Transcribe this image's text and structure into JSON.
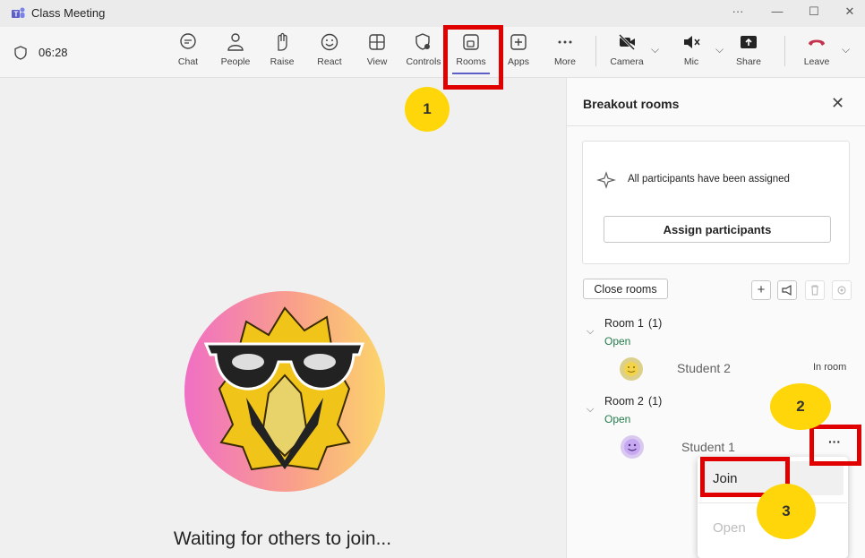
{
  "window": {
    "title": "Class Meeting",
    "controls": [
      "···",
      "—",
      "☐",
      "✕"
    ]
  },
  "toolbar": {
    "timer": "06:28",
    "items": [
      {
        "label": "Chat",
        "icon": "chat-icon"
      },
      {
        "label": "People",
        "icon": "people-icon"
      },
      {
        "label": "Raise",
        "icon": "raise-hand-icon"
      },
      {
        "label": "React",
        "icon": "react-icon"
      },
      {
        "label": "View",
        "icon": "view-icon"
      },
      {
        "label": "Controls",
        "icon": "controls-icon"
      },
      {
        "label": "Rooms",
        "icon": "rooms-icon"
      },
      {
        "label": "Apps",
        "icon": "apps-icon"
      },
      {
        "label": "More",
        "icon": "more-icon"
      }
    ],
    "camera": "Camera",
    "mic": "Mic",
    "share": "Share",
    "leave": "Leave"
  },
  "stage": {
    "waiting_text": "Waiting for others to join..."
  },
  "panel": {
    "title": "Breakout rooms",
    "assigned_text": "All participants have been assigned",
    "assign_button": "Assign participants",
    "close_rooms_button": "Close rooms",
    "rooms": [
      {
        "name": "Room 1",
        "count": "(1)",
        "status": "Open",
        "participant": "Student 2",
        "participant_status": "In room"
      },
      {
        "name": "Room 2",
        "count": "(1)",
        "status": "Open",
        "participant": "Student 1",
        "participant_status": ""
      }
    ],
    "more_button": "···",
    "menu": {
      "join": "Join",
      "open": "Open"
    }
  },
  "annotations": {
    "step1": "1",
    "step2": "2",
    "step3": "3"
  },
  "colors": {
    "accent": "#5b5fc7",
    "leave": "#c4314b",
    "open_status": "#237b4b",
    "highlight": "#e00000",
    "badge": "#ffd60a"
  }
}
